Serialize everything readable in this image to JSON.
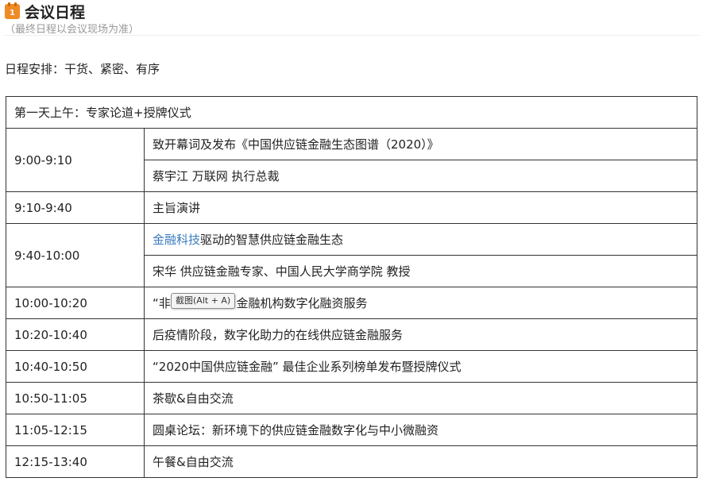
{
  "header": {
    "icon_label": "1",
    "title": "会议日程",
    "subtitle": "（最终日程以会议现场为准）"
  },
  "intro": "日程安排：干货、紧密、有序",
  "schedule": {
    "section_title": "第一天上午：专家论道+授牌仪式",
    "rows": [
      {
        "time": "9:00-9:10",
        "items": [
          "致开幕词及发布《中国供应链金融生态图谱（2020）》",
          "蔡宇江 万联网 执行总裁"
        ]
      },
      {
        "time": "9:10-9:40",
        "items": [
          "主旨演讲"
        ]
      },
      {
        "time": "9:40-10:00",
        "link": "金融科技",
        "rest": "驱动的智慧供应链金融生态",
        "speaker": "宋华  供应链金融专家、中国人民大学商学院 教授"
      },
      {
        "time": "10:00-10:20",
        "items": [
          "“非接触服务”与金融机构数字化融资服务"
        ]
      },
      {
        "time": "10:20-10:40",
        "items": [
          "后疫情阶段，数字化助力的在线供应链金融服务"
        ]
      },
      {
        "time": "10:40-10:50",
        "items": [
          "“2020中国供应链金融” 最佳企业系列榜单发布暨授牌仪式"
        ]
      },
      {
        "time": "10:50-11:05",
        "items": [
          " 茶歇&自由交流"
        ]
      },
      {
        "time": "11:05-12:15",
        "items": [
          "圆桌论坛：新环境下的供应链金融数字化与中小微融资"
        ]
      },
      {
        "time": "12:15-13:40",
        "items": [
          "午餐&自由交流"
        ]
      }
    ]
  },
  "tooltip": "截图(Alt + A)",
  "colors": {
    "icon": "#f08a24",
    "link": "#3a7bbf",
    "border": "#333333",
    "subtitle": "#999999"
  }
}
